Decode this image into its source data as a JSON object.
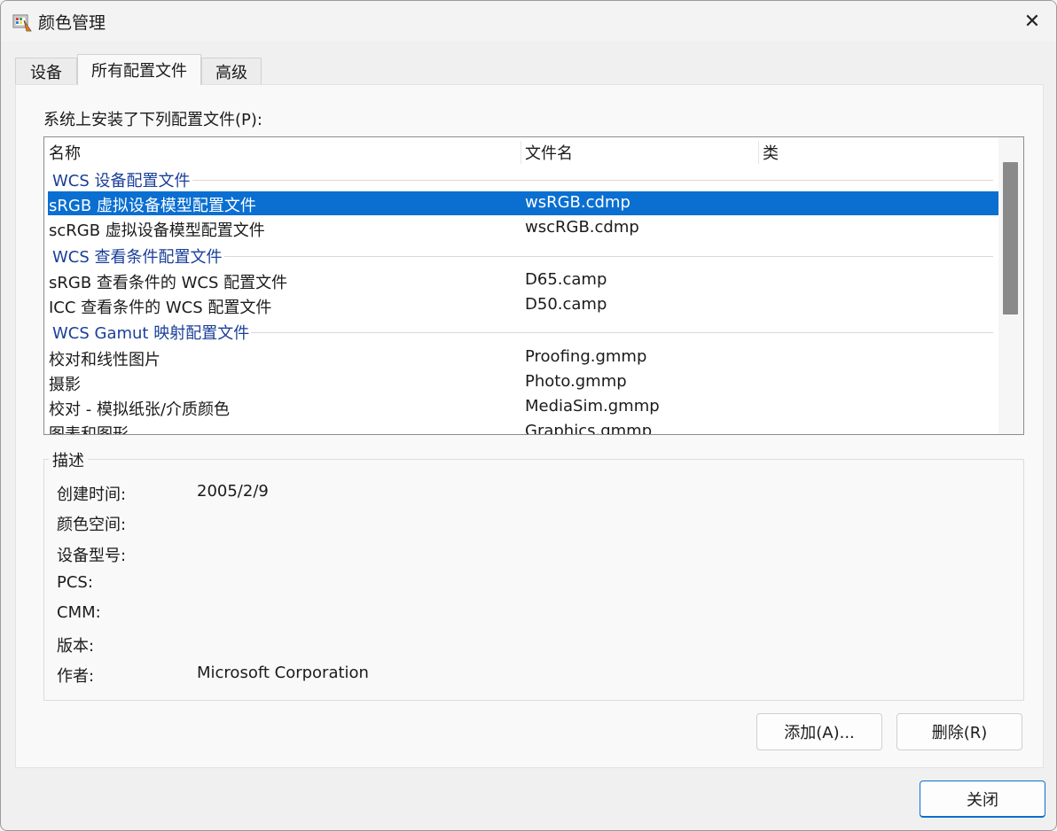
{
  "window": {
    "title": "颜色管理",
    "app_icon": "color-management-icon",
    "close_icon": "close-icon"
  },
  "tabs": [
    {
      "label": "设备"
    },
    {
      "label": "所有配置文件",
      "active": true
    },
    {
      "label": "高级"
    }
  ],
  "installed_label": "系统上安装了下列配置文件(P):",
  "list": {
    "columns": [
      "名称",
      "文件名",
      "类"
    ],
    "groups": [
      {
        "label": "WCS 设备配置文件",
        "rows": [
          {
            "name": "sRGB 虚拟设备模型配置文件",
            "file": "wsRGB.cdmp",
            "selected": true
          },
          {
            "name": "scRGB 虚拟设备模型配置文件",
            "file": "wscRGB.cdmp"
          }
        ]
      },
      {
        "label": "WCS 查看条件配置文件",
        "rows": [
          {
            "name": "sRGB 查看条件的 WCS 配置文件",
            "file": "D65.camp"
          },
          {
            "name": "ICC 查看条件的 WCS 配置文件",
            "file": "D50.camp"
          }
        ]
      },
      {
        "label": "WCS Gamut 映射配置文件",
        "rows": [
          {
            "name": "校对和线性图片",
            "file": "Proofing.gmmp"
          },
          {
            "name": "摄影",
            "file": "Photo.gmmp"
          },
          {
            "name": "校对 - 模拟纸张/介质颜色",
            "file": "MediaSim.gmmp"
          },
          {
            "name": "图表和图形",
            "file": "Graphics.gmmp"
          }
        ]
      }
    ]
  },
  "description": {
    "title": "描述",
    "items": [
      {
        "key": "创建时间:",
        "value": "2005/2/9"
      },
      {
        "key": "颜色空间:",
        "value": ""
      },
      {
        "key": "设备型号:",
        "value": ""
      },
      {
        "key": "PCS:",
        "value": ""
      },
      {
        "key": "CMM:",
        "value": ""
      },
      {
        "key": "版本:",
        "value": ""
      },
      {
        "key": "作者:",
        "value": "Microsoft Corporation"
      }
    ]
  },
  "buttons": {
    "add": "添加(A)...",
    "remove": "删除(R)",
    "close": "关闭"
  },
  "colors": {
    "selection": "#0a6fd1",
    "group_text": "#1a3f99"
  }
}
